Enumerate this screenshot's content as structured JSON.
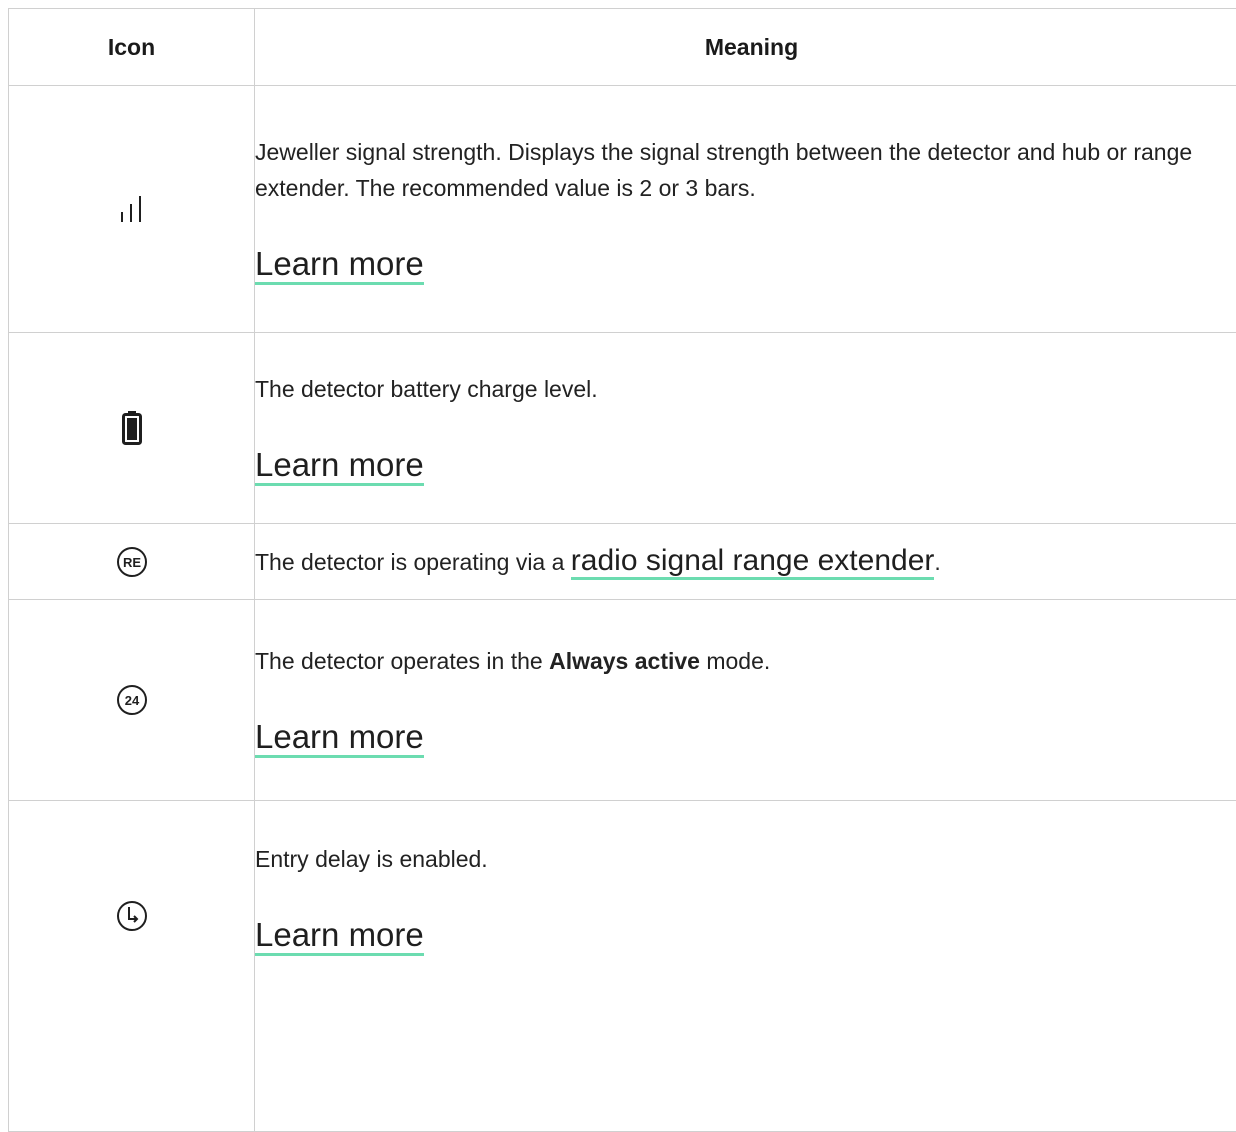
{
  "table": {
    "header": {
      "icon": "Icon",
      "meaning": "Meaning"
    },
    "rows": [
      {
        "icon": "signal-strength-icon",
        "text": "Jeweller signal strength. Displays the signal strength between the detector and hub or range extender. The recommended value is 2 or 3 bars.",
        "link": "Learn more"
      },
      {
        "icon": "battery-icon",
        "text": "The detector battery charge level.",
        "link": "Learn more"
      },
      {
        "icon": "range-extender-icon",
        "icon_text": "RE",
        "text_before": "The detector is operating via a ",
        "link": "radio signal range extender",
        "text_after": "."
      },
      {
        "icon": "always-active-icon",
        "icon_text": "24",
        "text_before": "The detector operates in the ",
        "text_bold": "Always active",
        "text_after": " mode.",
        "link": "Learn more"
      },
      {
        "icon": "entry-delay-icon",
        "text": "Entry delay is enabled.",
        "link": "Learn more"
      }
    ]
  },
  "colors": {
    "link_underline": "#6cdcb0",
    "border": "#d0d0d0",
    "text": "#222222"
  }
}
